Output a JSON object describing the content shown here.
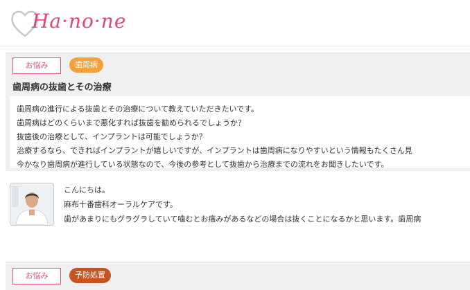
{
  "brand": {
    "logo_text": "Ha·no·ne"
  },
  "question": {
    "tag_category": "お悩み",
    "tag_topic": "歯周病",
    "title": "歯周病の抜歯とその治療",
    "lines": [
      "歯周病の進行による抜歯とその治療について教えていただきたいです。",
      "歯周病はどのくらいまで悪化すれば抜歯を勧められるでしょうか？",
      "抜歯後の治療として、インプラントは可能でしょうか？",
      "治療するなら、できればインプラントが嬉しいですが、インプラントは歯周病になりやすいという情報もたくさん見",
      "今かなり歯周病が進行している状態なので、今後の参考として抜歯から治療までの流れをお聞きしたいです。"
    ]
  },
  "answer": {
    "lines": [
      "こんにちは。",
      "麻布十番歯科オーラルケアです。",
      "歯があまりにもグラグラしていて噛むとお痛みがあるなどの場合は抜くことになるかと思います。歯周病"
    ]
  },
  "next_item": {
    "tag_category": "お悩み",
    "tag_topic": "予防処置"
  }
}
